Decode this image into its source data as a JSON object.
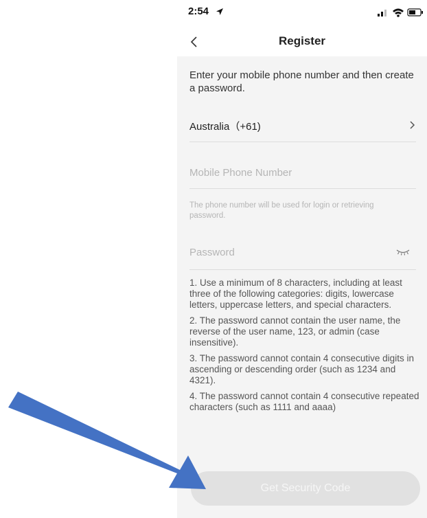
{
  "status_bar": {
    "time": "2:54"
  },
  "header": {
    "title": "Register"
  },
  "intro_text": "Enter your mobile phone number and then create a password.",
  "country": {
    "label": "Australia（+61)"
  },
  "phone": {
    "placeholder": "Mobile Phone Number",
    "value": "",
    "hint": "The phone number will be used for login or retrieving password."
  },
  "password": {
    "placeholder": "Password",
    "value": ""
  },
  "rules": [
    "1. Use a minimum of 8 characters, including at least three of the following categories: digits, lowercase letters, uppercase letters, and special characters.",
    "2. The password cannot contain the user name, the reverse of the user name, 123, or admin (case insensitive).",
    "3. The password cannot contain 4 consecutive digits in ascending or descending order (such as 1234 and 4321).",
    "4. The password cannot contain 4 consecutive repeated characters (such as 1111 and aaaa)"
  ],
  "submit_button": {
    "label": "Get Security Code",
    "enabled": false
  },
  "colors": {
    "arrow": "#4472c4",
    "button_disabled": "#e1e1e1",
    "panel_background": "#f4f4f4"
  },
  "icons": [
    "location-arrow-icon",
    "signal-icon",
    "wifi-icon",
    "battery-icon",
    "back-chevron-icon",
    "chevron-right-icon",
    "eye-closed-icon"
  ]
}
